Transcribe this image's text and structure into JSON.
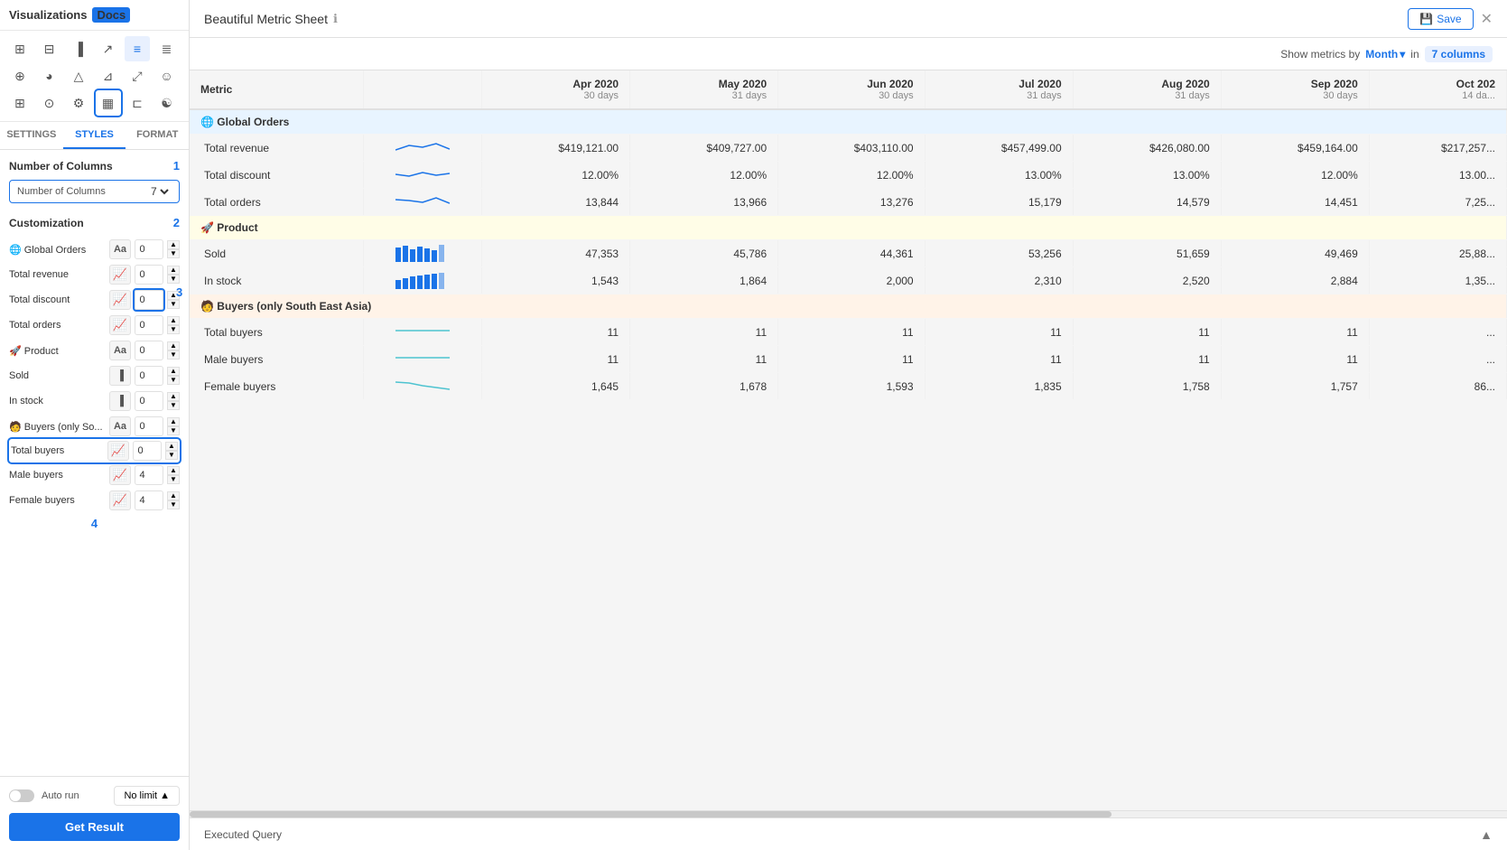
{
  "sidebar": {
    "title": "Visualizations",
    "docs_badge": "Docs",
    "tabs": [
      "SETTINGS",
      "STYLES",
      "FORMAT"
    ],
    "active_tab": "STYLES",
    "number_of_columns": {
      "label": "Number of Columns",
      "value": "7",
      "number": "1"
    },
    "customization": {
      "label": "Customization",
      "number": "2",
      "metrics": [
        {
          "name": "Global Orders",
          "icon_type": "aa",
          "value": 0,
          "emoji": "🌐"
        },
        {
          "name": "Total revenue",
          "icon_type": "chart",
          "value": 0
        },
        {
          "name": "Total discount",
          "icon_type": "chart",
          "value": 0,
          "number_badge": "3"
        },
        {
          "name": "Total orders",
          "icon_type": "chart",
          "value": 0
        },
        {
          "name": "🚀 Product",
          "icon_type": "aa",
          "value": 0
        },
        {
          "name": "Sold",
          "icon_type": "bar",
          "value": 0
        },
        {
          "name": "In stock",
          "icon_type": "bar",
          "value": 0
        },
        {
          "name": "Buyers (only So...",
          "icon_type": "aa",
          "value": 0,
          "emoji": "🧑"
        },
        {
          "name": "Total buyers",
          "icon_type": "chart",
          "value": 0,
          "outlined": true
        },
        {
          "name": "Male buyers",
          "icon_type": "chart",
          "value": 4
        },
        {
          "name": "Female buyers",
          "icon_type": "chart",
          "value": 4,
          "number_badge": "4"
        }
      ]
    }
  },
  "footer": {
    "auto_run_label": "Auto run",
    "no_limit_label": "No limit",
    "get_result_label": "Get Result"
  },
  "top_bar": {
    "title": "Beautiful Metric Sheet",
    "save_label": "Save"
  },
  "metrics_bar": {
    "label": "Show metrics by",
    "period": "Month",
    "columns_label": "7 columns"
  },
  "table": {
    "columns": [
      {
        "header": "Metric",
        "sub": ""
      },
      {
        "header": "",
        "sub": ""
      },
      {
        "header": "Apr 2020",
        "sub": "30 days"
      },
      {
        "header": "May 2020",
        "sub": "31 days"
      },
      {
        "header": "Jun 2020",
        "sub": "30 days"
      },
      {
        "header": "Jul 2020",
        "sub": "31 days"
      },
      {
        "header": "Aug 2020",
        "sub": "31 days"
      },
      {
        "header": "Sep 2020",
        "sub": "30 days"
      },
      {
        "header": "Oct 202",
        "sub": "14 da..."
      }
    ],
    "groups": [
      {
        "name": "🌐 Global Orders",
        "type": "global",
        "rows": [
          {
            "metric": "Total revenue",
            "sparkline": "line",
            "values": [
              "$419,121.00",
              "$409,727.00",
              "$403,110.00",
              "$457,499.00",
              "$426,080.00",
              "$459,164.00",
              "$217,257..."
            ]
          },
          {
            "metric": "Total discount",
            "sparkline": "line",
            "values": [
              "12.00%",
              "12.00%",
              "12.00%",
              "13.00%",
              "13.00%",
              "12.00%",
              "13.00..."
            ]
          },
          {
            "metric": "Total orders",
            "sparkline": "line",
            "values": [
              "13,844",
              "13,966",
              "13,276",
              "15,179",
              "14,579",
              "14,451",
              "7,25..."
            ]
          }
        ]
      },
      {
        "name": "🚀 Product",
        "type": "product",
        "rows": [
          {
            "metric": "Sold",
            "sparkline": "bar",
            "values": [
              "47,353",
              "45,786",
              "44,361",
              "53,256",
              "51,659",
              "49,469",
              "25,88..."
            ]
          },
          {
            "metric": "In stock",
            "sparkline": "bar",
            "values": [
              "1,543",
              "1,864",
              "2,000",
              "2,310",
              "2,520",
              "2,884",
              "1,35..."
            ]
          }
        ]
      },
      {
        "name": "🧑 Buyers (only South East Asia)",
        "type": "buyers",
        "rows": [
          {
            "metric": "Total buyers",
            "sparkline": "line",
            "values": [
              "11",
              "11",
              "11",
              "11",
              "11",
              "11",
              "..."
            ]
          },
          {
            "metric": "Male buyers",
            "sparkline": "line",
            "values": [
              "11",
              "11",
              "11",
              "11",
              "11",
              "11",
              "..."
            ]
          },
          {
            "metric": "Female buyers",
            "sparkline": "line",
            "values": [
              "1,645",
              "1,678",
              "1,593",
              "1,835",
              "1,758",
              "1,757",
              "86..."
            ]
          }
        ]
      }
    ]
  },
  "executed_query": {
    "label": "Executed Query"
  }
}
